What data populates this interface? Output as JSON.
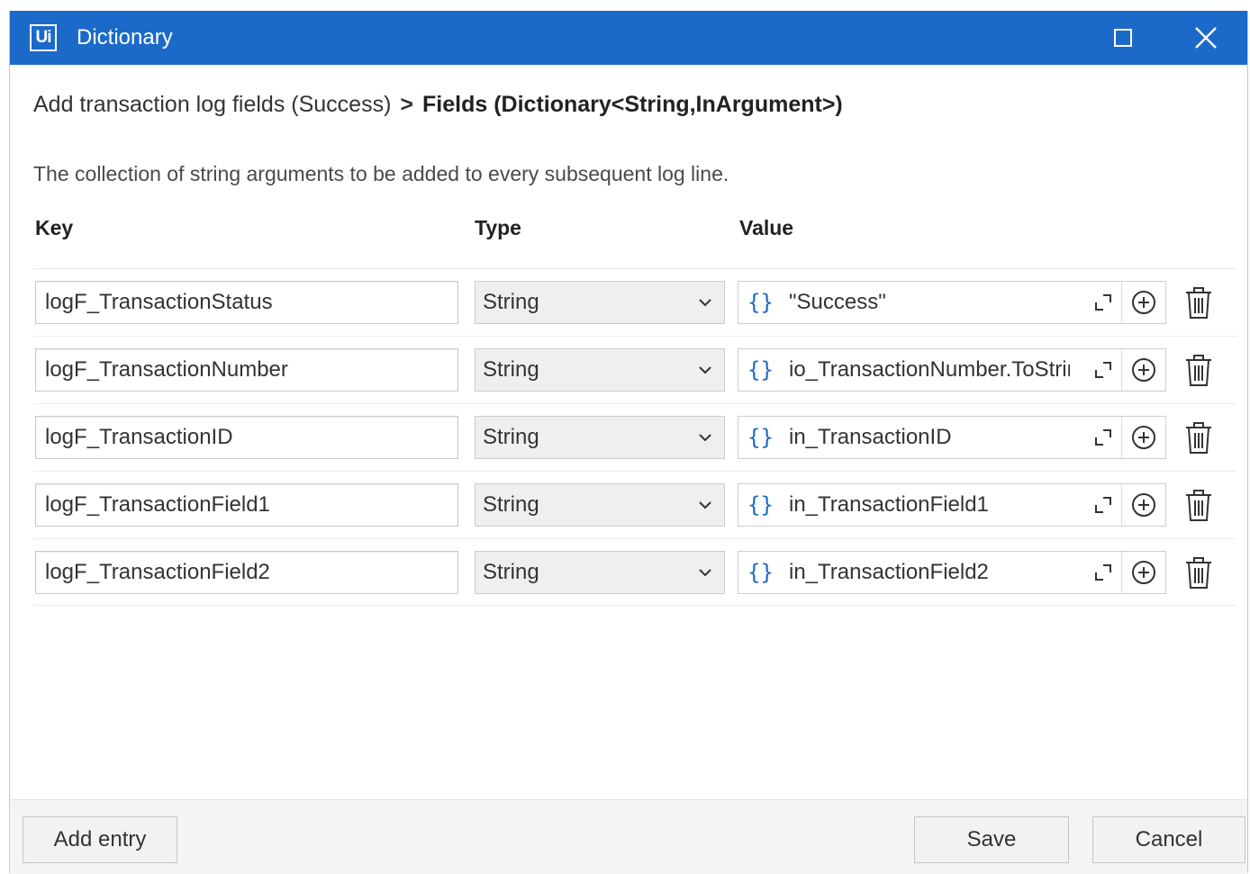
{
  "window": {
    "logo": "Ui",
    "title": "Dictionary"
  },
  "breadcrumb": {
    "parent": "Add transaction log fields (Success)",
    "separator": ">",
    "current": "Fields (Dictionary<String,InArgument>)"
  },
  "description": "The collection of string arguments to be added to every subsequent log line.",
  "columns": {
    "key": "Key",
    "type": "Type",
    "value": "Value"
  },
  "rows": [
    {
      "key": "logF_TransactionStatus",
      "type": "String",
      "value": "\"Success\""
    },
    {
      "key": "logF_TransactionNumber",
      "type": "String",
      "value": "io_TransactionNumber.ToString"
    },
    {
      "key": "logF_TransactionID",
      "type": "String",
      "value": "in_TransactionID"
    },
    {
      "key": "logF_TransactionField1",
      "type": "String",
      "value": "in_TransactionField1"
    },
    {
      "key": "logF_TransactionField2",
      "type": "String",
      "value": "in_TransactionField2"
    }
  ],
  "value_prefix": "{}",
  "footer": {
    "add_entry": "Add entry",
    "save": "Save",
    "cancel": "Cancel"
  },
  "colors": {
    "titlebar": "#1b6ac9",
    "accent": "#1b6ac9"
  },
  "icons": {
    "close": "close-icon",
    "maximize": "maximize-icon",
    "chevron": "chevron-down-icon",
    "expand": "expand-icon",
    "add": "plus-circle-icon",
    "delete": "trash-icon"
  }
}
